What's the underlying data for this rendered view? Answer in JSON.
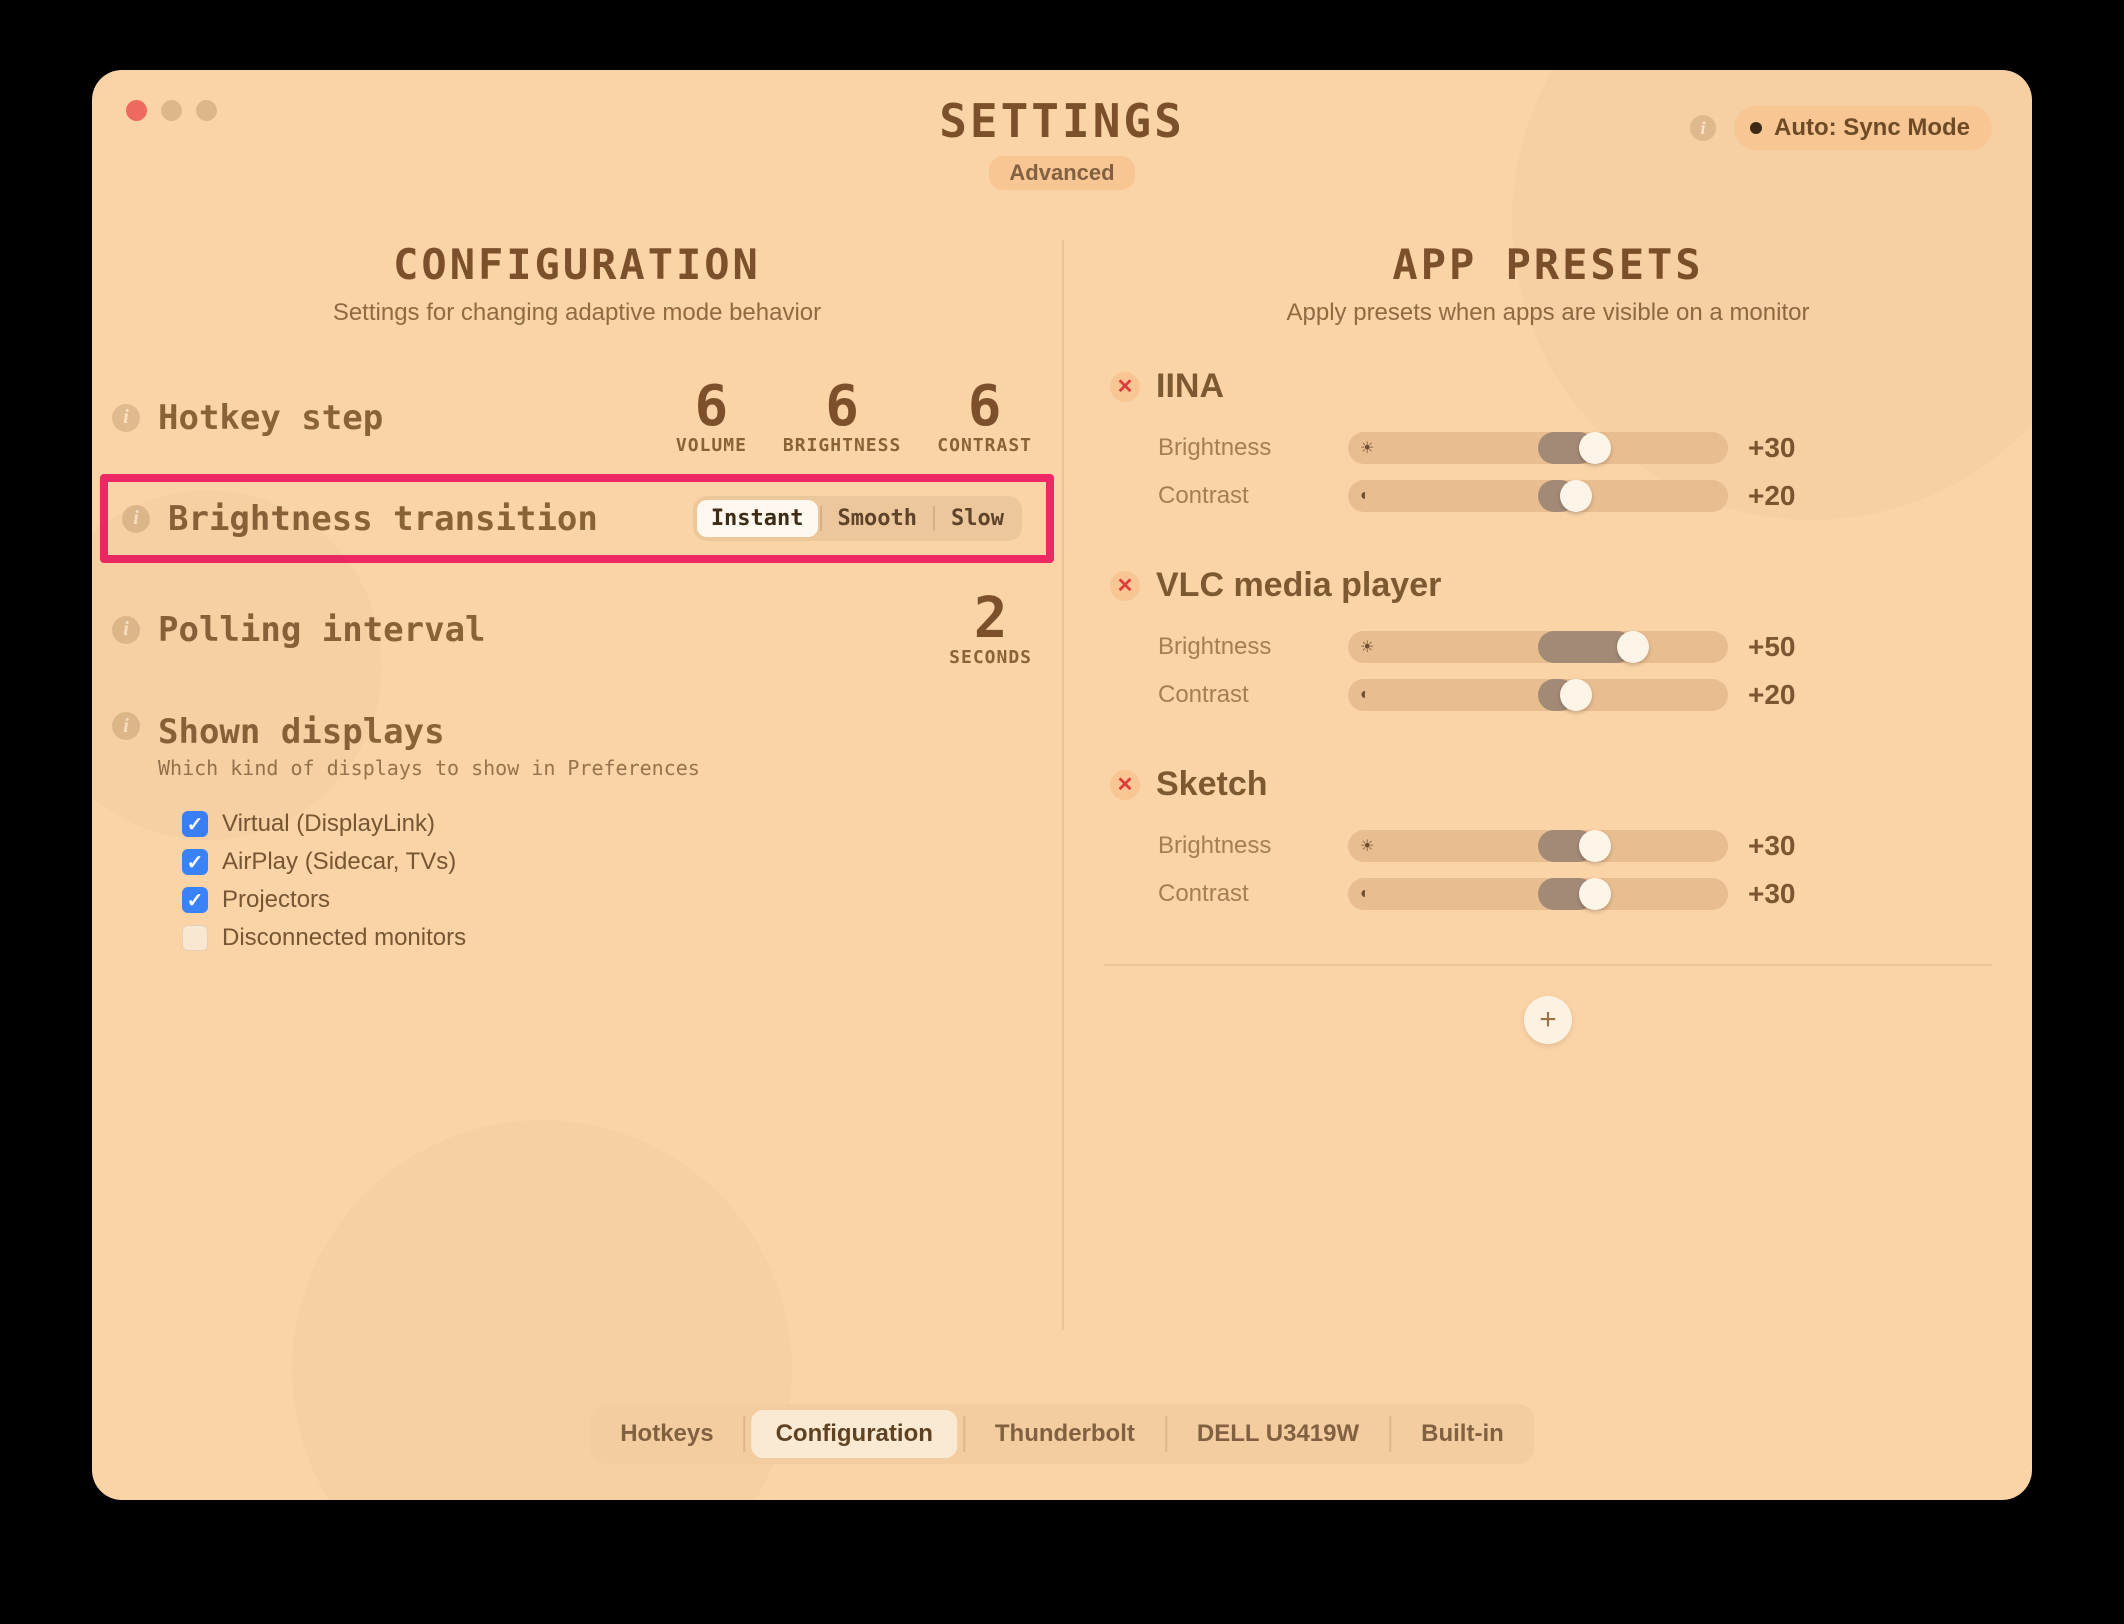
{
  "header": {
    "title": "SETTINGS",
    "badge": "Advanced",
    "mode_label": "Auto: Sync Mode"
  },
  "config": {
    "title": "CONFIGURATION",
    "subtitle": "Settings for changing adaptive mode behavior",
    "hotkey_label": "Hotkey step",
    "steps": {
      "volume": {
        "value": "6",
        "caption": "VOLUME"
      },
      "brightness": {
        "value": "6",
        "caption": "BRIGHTNESS"
      },
      "contrast": {
        "value": "6",
        "caption": "CONTRAST"
      }
    },
    "transition_label": "Brightness transition",
    "transition_options": {
      "instant": "Instant",
      "smooth": "Smooth",
      "slow": "Slow"
    },
    "transition_selected": "instant",
    "polling_label": "Polling interval",
    "polling_value": "2",
    "polling_caption": "SECONDS",
    "shown_label": "Shown displays",
    "shown_sub": "Which kind of displays to show in Preferences",
    "checks": [
      {
        "label": "Virtual (DisplayLink)",
        "checked": true
      },
      {
        "label": "AirPlay (Sidecar, TVs)",
        "checked": true
      },
      {
        "label": "Projectors",
        "checked": true
      },
      {
        "label": "Disconnected monitors",
        "checked": false
      }
    ]
  },
  "presets": {
    "title": "APP PRESETS",
    "subtitle": "Apply presets when apps are visible on a monitor",
    "brightness_label": "Brightness",
    "contrast_label": "Contrast",
    "items": [
      {
        "name": "IINA",
        "brightness": "+30",
        "b_pct": 65,
        "contrast": "+20",
        "c_pct": 60
      },
      {
        "name": "VLC media player",
        "brightness": "+50",
        "b_pct": 75,
        "contrast": "+20",
        "c_pct": 60
      },
      {
        "name": "Sketch",
        "brightness": "+30",
        "b_pct": 65,
        "contrast": "+30",
        "c_pct": 65
      }
    ]
  },
  "tabs": {
    "hotkeys": "Hotkeys",
    "configuration": "Configuration",
    "thunderbolt": "Thunderbolt",
    "dell": "DELL U3419W",
    "builtin": "Built-in"
  }
}
